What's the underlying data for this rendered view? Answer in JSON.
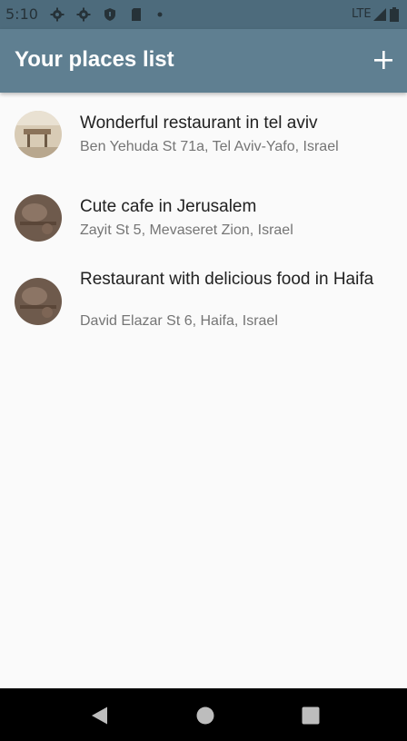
{
  "status_bar": {
    "time": "5:10",
    "network": "LTE",
    "icons": [
      "gear-icon",
      "gear-icon",
      "shield-icon",
      "sd-card-icon",
      "dot-icon",
      "signal-icon",
      "battery-icon"
    ]
  },
  "app_bar": {
    "title": "Your places list",
    "add_icon": "plus-icon"
  },
  "places": [
    {
      "title": "Wonderful restaurant in tel aviv",
      "address": "Ben Yehuda St 71a, Tel Aviv-Yafo, Israel"
    },
    {
      "title": "Cute cafe in Jerusalem",
      "address": "Zayit St 5, Mevaseret Zion, Israel"
    },
    {
      "title": "Restaurant with delicious food in Haifa",
      "address": "David Elazar St 6, Haifa, Israel"
    }
  ],
  "nav_bar": {
    "icons": [
      "back-icon",
      "home-icon",
      "recents-icon"
    ]
  },
  "colors": {
    "app_bar": "#5f7f91",
    "status_bar": "#4d6b7c",
    "background": "#fafafa",
    "title_text": "#212121",
    "subtitle_text": "#757575"
  }
}
